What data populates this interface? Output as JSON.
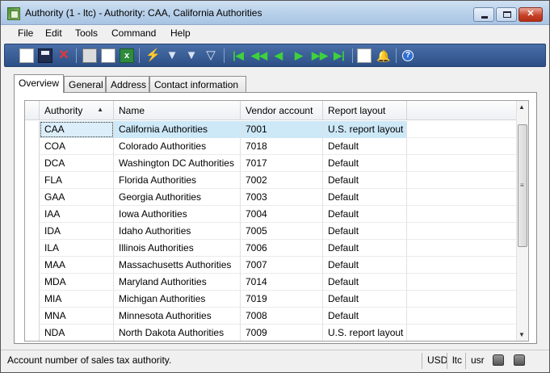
{
  "window": {
    "title": "Authority (1 - ltc) - Authority: CAA, California Authorities",
    "buttons": {
      "minimize": "minimize",
      "maximize": "maximize",
      "close": "✕"
    }
  },
  "menu": [
    "File",
    "Edit",
    "Tools",
    "Command",
    "Help"
  ],
  "toolbar": {
    "icons": [
      "new-record-icon",
      "save-icon",
      "delete-icon",
      "print-icon",
      "print-preview-icon",
      "export-excel-icon",
      "filter-by-selection-icon",
      "filter-icon",
      "advanced-filter-icon",
      "remove-filter-icon",
      "first-record-icon",
      "previous-page-icon",
      "previous-record-icon",
      "next-record-icon",
      "next-page-icon",
      "last-record-icon",
      "document-handling-icon",
      "alert-icon",
      "help-icon"
    ]
  },
  "tabs": [
    {
      "label": "Overview",
      "active": true
    },
    {
      "label": "General",
      "active": false
    },
    {
      "label": "Address",
      "active": false
    },
    {
      "label": "Contact information",
      "active": false
    }
  ],
  "grid": {
    "columns": [
      "Authority",
      "Name",
      "Vendor account",
      "Report layout"
    ],
    "sorted_column": "Authority",
    "rows": [
      {
        "authority": "CAA",
        "name": "California Authorities",
        "vendor": "7001",
        "layout": "U.S. report layout",
        "selected": true
      },
      {
        "authority": "COA",
        "name": "Colorado Authorities",
        "vendor": "7018",
        "layout": "Default"
      },
      {
        "authority": "DCA",
        "name": "Washington DC Authorities",
        "vendor": "7017",
        "layout": "Default"
      },
      {
        "authority": "FLA",
        "name": "Florida Authorities",
        "vendor": "7002",
        "layout": "Default"
      },
      {
        "authority": "GAA",
        "name": "Georgia Authorities",
        "vendor": "7003",
        "layout": "Default"
      },
      {
        "authority": "IAA",
        "name": "Iowa Authorities",
        "vendor": "7004",
        "layout": "Default"
      },
      {
        "authority": "IDA",
        "name": "Idaho Authorities",
        "vendor": "7005",
        "layout": "Default"
      },
      {
        "authority": "ILA",
        "name": "Illinois Authorities",
        "vendor": "7006",
        "layout": "Default"
      },
      {
        "authority": "MAA",
        "name": "Massachusetts Authorities",
        "vendor": "7007",
        "layout": "Default"
      },
      {
        "authority": "MDA",
        "name": "Maryland Authorities",
        "vendor": "7014",
        "layout": "Default"
      },
      {
        "authority": "MIA",
        "name": "Michigan Authorities",
        "vendor": "7019",
        "layout": "Default"
      },
      {
        "authority": "MNA",
        "name": "Minnesota Authorities",
        "vendor": "7008",
        "layout": "Default"
      },
      {
        "authority": "NDA",
        "name": "North Dakota Authorities",
        "vendor": "7009",
        "layout": "U.S. report layout"
      }
    ]
  },
  "status": {
    "message": "Account number of sales tax authority.",
    "currency": "USD",
    "company": "ltc",
    "user": "usr"
  },
  "colors": {
    "selected_row": "#cde8f7",
    "toolbar": "#2c4f86",
    "titlebar": "#b9d1ea"
  }
}
